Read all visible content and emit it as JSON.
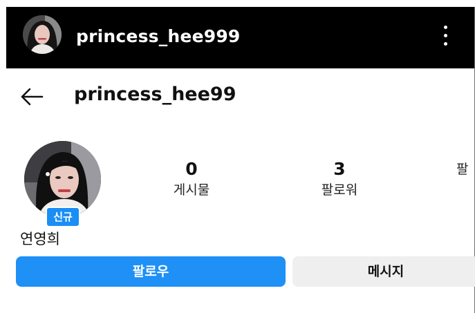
{
  "topbar": {
    "username": "princess_hee999",
    "menu_icon": "more-vertical-icon"
  },
  "header": {
    "back_icon": "arrow-left-icon",
    "title": "princess_hee99"
  },
  "profile": {
    "badge": "신규",
    "display_name": "연영희",
    "stats": [
      {
        "value": "0",
        "label": "게시물"
      },
      {
        "value": "3",
        "label": "팔로워"
      },
      {
        "value": "",
        "label": "팔"
      }
    ]
  },
  "actions": {
    "follow_label": "팔로우",
    "message_label": "메시지"
  },
  "colors": {
    "topbar_bg": "#000000",
    "badge_bg": "#1a8ef5",
    "follow_bg": "#1e90f6",
    "message_bg": "#efefef"
  }
}
